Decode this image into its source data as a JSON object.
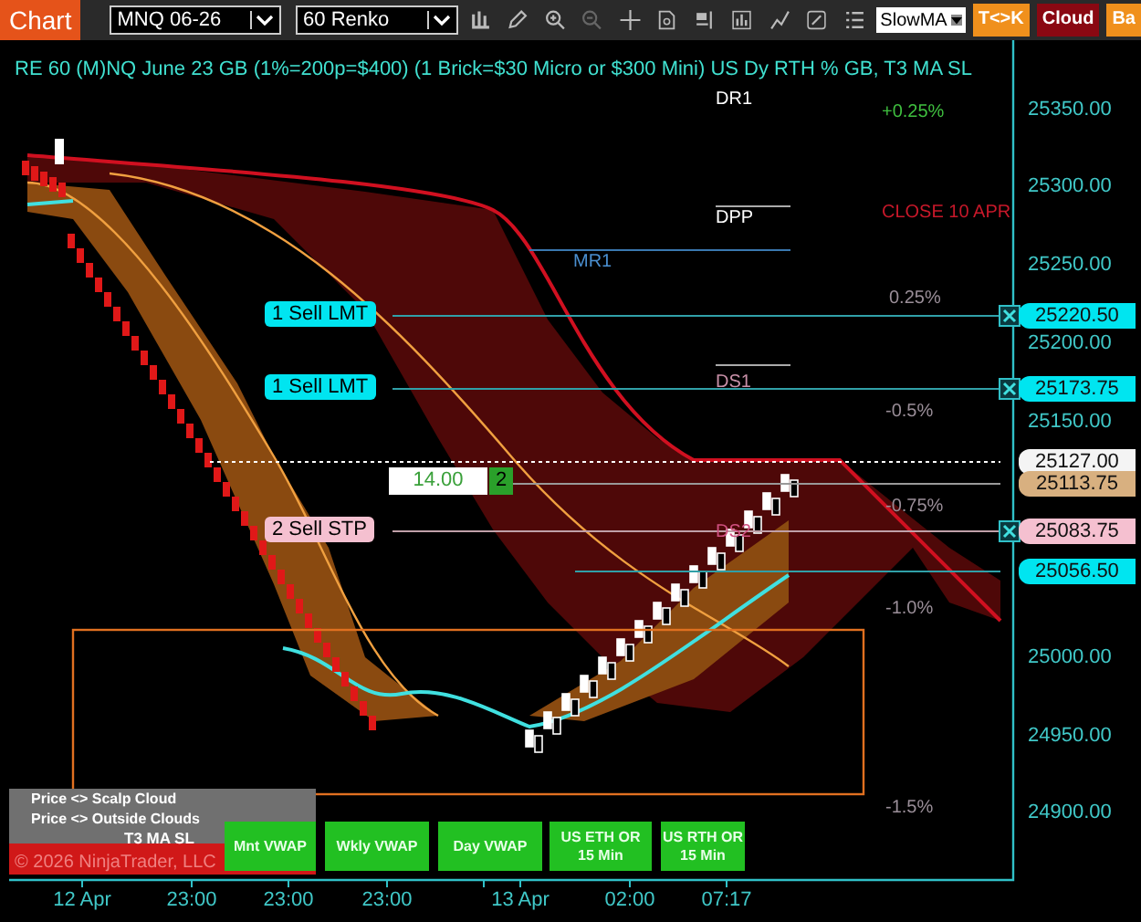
{
  "toolbar": {
    "tab": "Chart",
    "instrument": "MNQ 06-26",
    "period": "60 Renko",
    "indicator": "SlowMA",
    "toggles": [
      {
        "label": "T<>K",
        "color": "#f0901c"
      },
      {
        "label": "Cloud",
        "color": "#8a0812"
      },
      {
        "label": "Ba",
        "color": "#f0901c"
      }
    ]
  },
  "chart": {
    "title": "RE 60 (M)NQ June 23 GB (1%=200p=$400) (1 Brick=$30 Micro or $300 Mini) US Dy RTH % GB, T3 MA SL",
    "labels": [
      {
        "text": "DR1",
        "color": "#ffffff"
      },
      {
        "text": "+0.25%",
        "color": "#3fbf3f"
      },
      {
        "text": "DPP",
        "color": "#ffffff"
      },
      {
        "text": "MR1",
        "color": "#4a8fd0"
      },
      {
        "text": "CLOSE 10 APR",
        "color": "#c8182a"
      },
      {
        "text": "0.25%",
        "color": "#9a8e98"
      },
      {
        "text": "DS1",
        "color": "#c890a8"
      },
      {
        "text": "-0.5%",
        "color": "#9a8e98"
      },
      {
        "text": "-0.75%",
        "color": "#9a8e98"
      },
      {
        "text": "DS2",
        "color": "#d05080"
      },
      {
        "text": "-1.0%",
        "color": "#9a8e98"
      },
      {
        "text": "-1.5%",
        "color": "#9a8e98"
      }
    ],
    "orders": [
      {
        "label": "1 Sell LMT",
        "color": "#00e5f0"
      },
      {
        "label": "1 Sell LMT",
        "color": "#00e5f0"
      },
      {
        "label": "2 Sell STP",
        "color": "#f5c0d0"
      }
    ],
    "position": {
      "price": "14.00",
      "quantity": "2"
    },
    "legend": [
      "Price <> Scalp Cloud",
      "Price <> Outside Clouds"
    ],
    "legend_footer": "T3 MA SL",
    "copyright": "© 2026 NinjaTrader, LLC",
    "indicator_buttons": [
      "Mnt VWAP",
      "Wkly VWAP",
      "Day VWAP",
      "US ETH OR 15 Min",
      "US RTH OR 15 Min"
    ],
    "price_axis": [
      "25350.00",
      "25300.00",
      "25250.00",
      "25200.00",
      "25150.00",
      "25000.00",
      "24950.00",
      "24900.00"
    ],
    "price_tags": [
      {
        "text": "25220.50",
        "color": "#00e5f0"
      },
      {
        "text": "25173.75",
        "color": "#00e5f0"
      },
      {
        "text": "25127.00",
        "color": "#f4f4f4"
      },
      {
        "text": "25113.75",
        "color": "#d8b080"
      },
      {
        "text": "25083.75",
        "color": "#f5c0d0"
      },
      {
        "text": "25056.50",
        "color": "#00e5f0"
      }
    ],
    "time_axis": [
      "12 Apr",
      "23:00",
      "23:00",
      "23:00",
      "13 Apr",
      "02:00",
      "07:17"
    ]
  }
}
